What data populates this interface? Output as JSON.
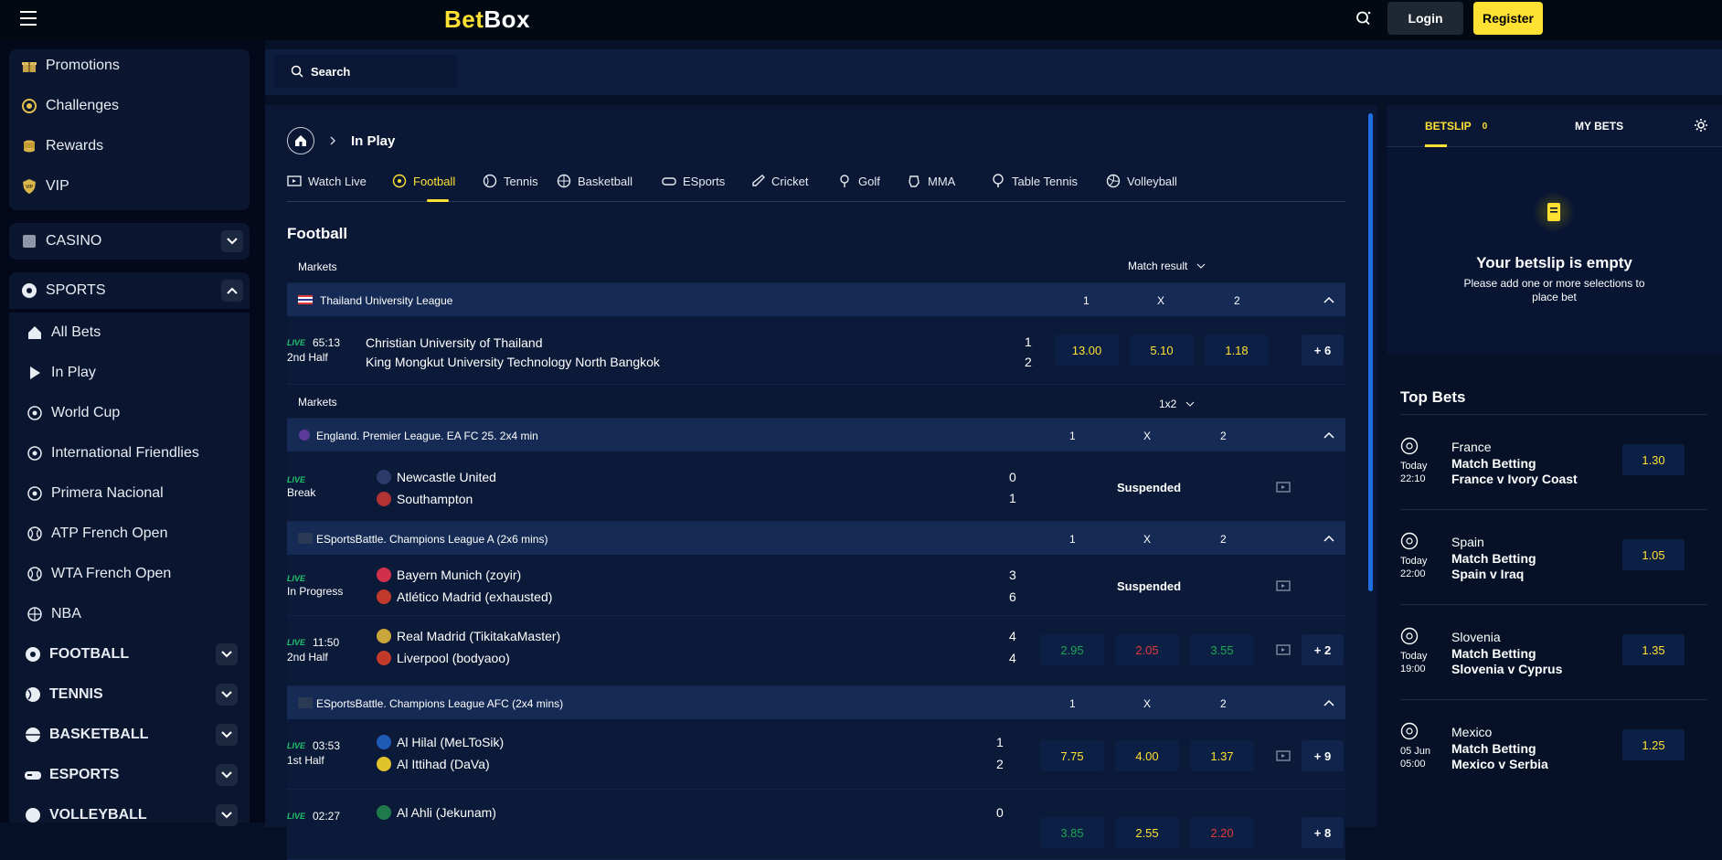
{
  "brand": {
    "part1": "Bet",
    "part2": "Box"
  },
  "header": {
    "login": "Login",
    "register": "Register"
  },
  "sidebar": {
    "top": [
      {
        "label": "Promotions",
        "icon": "gift-icon"
      },
      {
        "label": "Challenges",
        "icon": "target-icon"
      },
      {
        "label": "Rewards",
        "icon": "coins-icon"
      },
      {
        "label": "VIP",
        "icon": "vip-shield-icon"
      }
    ],
    "casino": "CASINO",
    "sports": "SPORTS",
    "sports_items": [
      {
        "label": "All Bets",
        "icon": "house-icon"
      },
      {
        "label": "In Play",
        "icon": "play-icon"
      },
      {
        "label": "World Cup",
        "icon": "football-icon"
      },
      {
        "label": "International Friendlies",
        "icon": "football-icon"
      },
      {
        "label": "Primera Nacional",
        "icon": "football-icon"
      },
      {
        "label": "ATP French Open",
        "icon": "tennis-icon"
      },
      {
        "label": "WTA French Open",
        "icon": "tennis-icon"
      },
      {
        "label": "NBA",
        "icon": "basketball-icon"
      }
    ],
    "sport_groups": [
      {
        "label": "FOOTBALL",
        "icon": "football-icon"
      },
      {
        "label": "TENNIS",
        "icon": "tennis-icon"
      },
      {
        "label": "BASKETBALL",
        "icon": "basketball-icon"
      },
      {
        "label": "ESPORTS",
        "icon": "gamepad-icon"
      },
      {
        "label": "VOLLEYBALL",
        "icon": "volleyball-icon"
      }
    ]
  },
  "search": {
    "placeholder": "Search"
  },
  "breadcrumb": {
    "current": "In Play"
  },
  "tabs": [
    "Watch Live",
    "Football",
    "Tennis",
    "Basketball",
    "ESports",
    "Cricket",
    "Golf",
    "MMA",
    "Table Tennis",
    "Volleyball"
  ],
  "active_tab": "Football",
  "section_title": "Football",
  "markets_label": "Markets",
  "market_select_1": "Match result",
  "market_select_2": "1x2",
  "cols": [
    "1",
    "X",
    "2"
  ],
  "live_label": "LIVE",
  "suspended": "Suspended",
  "leagues": [
    {
      "name": "Thailand University League"
    },
    {
      "name": "England. Premier League. EA FC 25. 2x4 min"
    },
    {
      "name": "ESportsBattle. Champions League A (2x6 mins)"
    },
    {
      "name": "ESportsBattle. Champions League AFC (2x4 mins)"
    }
  ],
  "matches": [
    {
      "time": "65:13",
      "phase": "2nd Half",
      "home": "Christian University of Thailand",
      "away": "King Mongkut University Technology North Bangkok",
      "hs": "1",
      "as": "2",
      "o1": "13.00",
      "ox": "5.10",
      "o2": "1.18",
      "more": "+ 6"
    },
    {
      "time": "",
      "phase": "Break",
      "home": "Newcastle United",
      "away": "Southampton",
      "hs": "0",
      "as": "1"
    },
    {
      "time": "",
      "phase": "In Progress",
      "home": "Bayern Munich (zoyir)",
      "away": "Atlético Madrid (exhausted)",
      "hs": "3",
      "as": "6"
    },
    {
      "time": "11:50",
      "phase": "2nd Half",
      "home": "Real Madrid (TikitakaMaster)",
      "away": "Liverpool (bodyaoo)",
      "hs": "4",
      "as": "4",
      "o1": "2.95",
      "ox": "2.05",
      "o2": "3.55",
      "more": "+ 2"
    },
    {
      "time": "03:53",
      "phase": "1st Half",
      "home": "Al Hilal (MeLToSik)",
      "away": "Al Ittihad (DaVa)",
      "hs": "1",
      "as": "2",
      "o1": "7.75",
      "ox": "4.00",
      "o2": "1.37",
      "more": "+ 9"
    },
    {
      "time": "02:27",
      "phase": "",
      "home": "Al Ahli (Jekunam)",
      "away": "",
      "hs": "0",
      "as": "",
      "o1": "3.85",
      "ox": "2.55",
      "o2": "2.20",
      "more": "+ 8"
    }
  ],
  "betslip": {
    "tab1": "BETSLIP",
    "count": "0",
    "tab2": "MY BETS",
    "empty_title": "Your betslip is empty",
    "empty_line1": "Please add one or more selections to",
    "empty_line2": "place bet"
  },
  "top_bets_title": "Top Bets",
  "top_bets": [
    {
      "team": "France",
      "market": "Match Betting",
      "event": "France v Ivory Coast",
      "day": "Today",
      "time": "22:10",
      "odd": "1.30"
    },
    {
      "team": "Spain",
      "market": "Match Betting",
      "event": "Spain v Iraq",
      "day": "Today",
      "time": "22:00",
      "odd": "1.05"
    },
    {
      "team": "Slovenia",
      "market": "Match Betting",
      "event": "Slovenia v Cyprus",
      "day": "Today",
      "time": "19:00",
      "odd": "1.35"
    },
    {
      "team": "Mexico",
      "market": "Match Betting",
      "event": "Mexico v Serbia",
      "day": "05 Jun",
      "time": "05:00",
      "odd": "1.25"
    }
  ],
  "colors": {
    "accent": "#ffe134",
    "live": "#21c06a",
    "odd_up": "#1fa654",
    "odd_down": "#e23b3b"
  }
}
